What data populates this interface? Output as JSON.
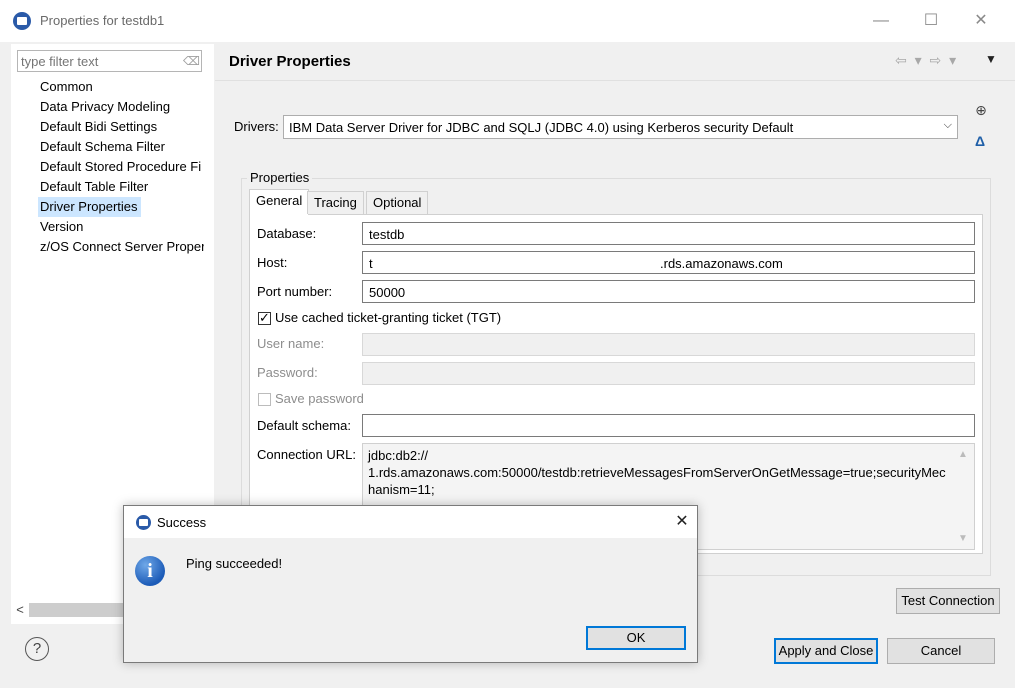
{
  "window": {
    "title": "Properties for testdb1"
  },
  "filter": {
    "placeholder": "type filter text"
  },
  "tree": {
    "items": [
      {
        "label": "Common"
      },
      {
        "label": "Data Privacy Modeling"
      },
      {
        "label": "Default Bidi Settings"
      },
      {
        "label": "Default Schema Filter"
      },
      {
        "label": "Default Stored Procedure Fi"
      },
      {
        "label": "Default Table Filter"
      },
      {
        "label": "Driver Properties",
        "selected": true
      },
      {
        "label": "Version"
      },
      {
        "label": "z/OS Connect Server Proper"
      }
    ]
  },
  "page": {
    "title": "Driver Properties"
  },
  "drivers": {
    "label": "Drivers:",
    "selected": "IBM Data Server Driver for JDBC and SQLJ (JDBC 4.0) using Kerberos security Default"
  },
  "properties": {
    "group_label": "Properties",
    "tabs": [
      "General",
      "Tracing",
      "Optional"
    ],
    "database": {
      "label": "Database:",
      "value": "testdb"
    },
    "host": {
      "label": "Host:",
      "value_prefix": "t",
      "value_suffix": ".rds.amazonaws.com"
    },
    "port": {
      "label": "Port number:",
      "value": "50000"
    },
    "use_tgt": {
      "label": "Use cached ticket-granting ticket (TGT)",
      "checked": true
    },
    "user_name": {
      "label": "User name:",
      "value": ""
    },
    "password": {
      "label": "Password:",
      "value": ""
    },
    "save_password": {
      "label": "Save password",
      "checked": false
    },
    "default_schema": {
      "label": "Default schema:",
      "value": ""
    },
    "connection_url": {
      "label": "Connection URL:",
      "line1": "jdbc:db2://",
      "line2": "1.rds.amazonaws.com:50000/testdb:retrieveMessagesFromServerOnGetMessage=true;securityMec",
      "line3": "hanism=11;"
    }
  },
  "buttons": {
    "test_connection": "Test Connection",
    "apply_close": "Apply and Close",
    "cancel": "Cancel"
  },
  "dialog": {
    "title": "Success",
    "message": "Ping succeeded!",
    "ok": "OK"
  }
}
